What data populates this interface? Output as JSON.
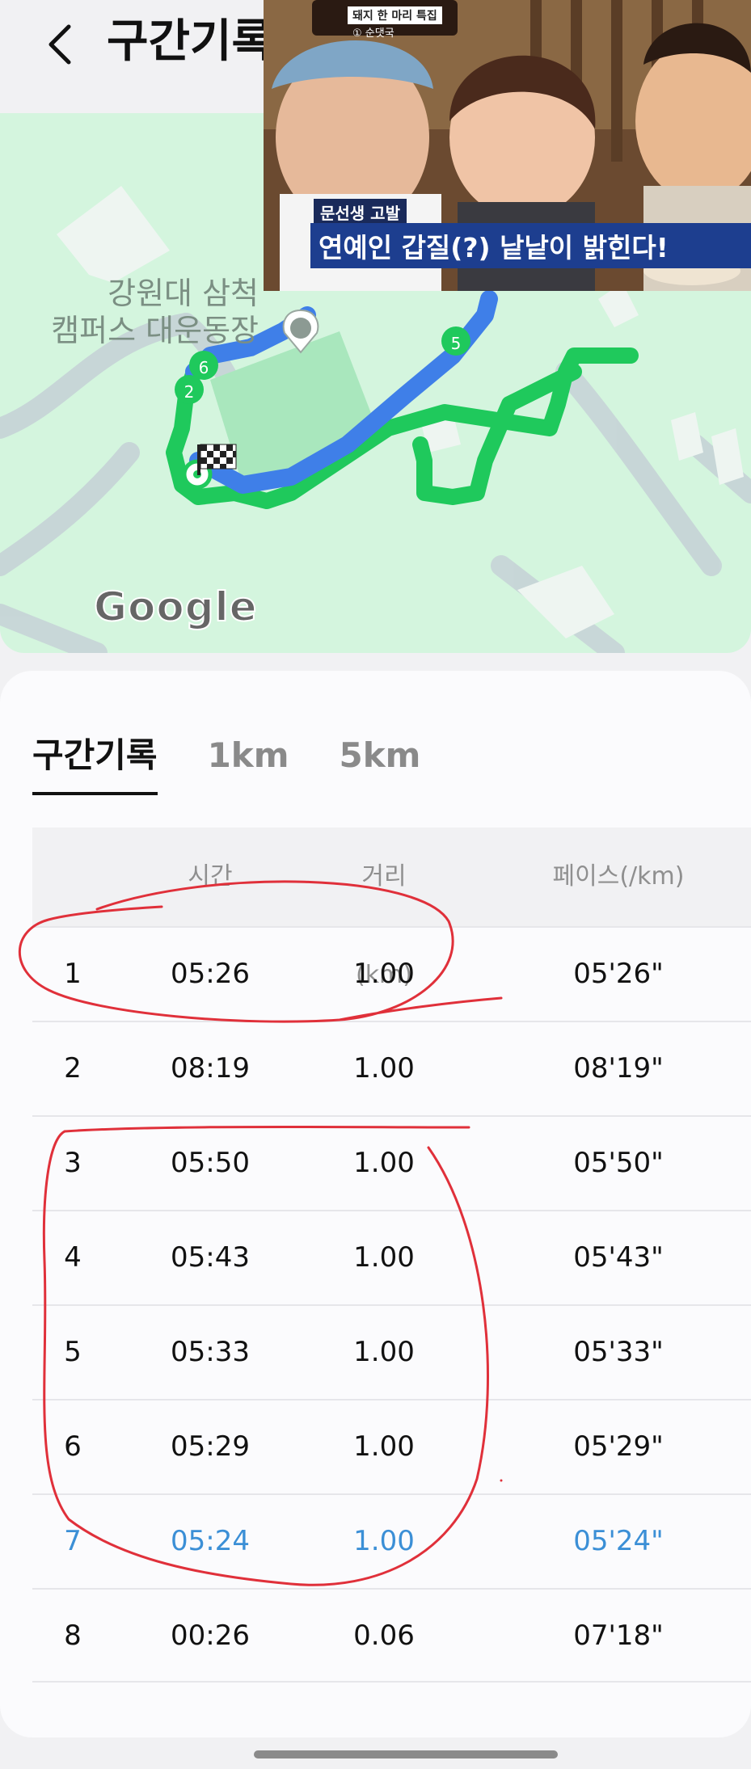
{
  "header": {
    "title": "구간기록"
  },
  "map": {
    "place_label_line1": "강원대 삼척",
    "place_label_line2": "캠퍼스 대운동장",
    "markers": [
      "6",
      "2",
      "5"
    ],
    "logo": "Google"
  },
  "video_overlay": {
    "show_badge": "돼지 한 마리 특집",
    "episode": "① 순댓국",
    "caption_small": "문선생 고발",
    "caption_main": "연예인 갑질(?) 낱낱이 밝힌다!"
  },
  "tabs": [
    {
      "label": "구간기록",
      "active": true
    },
    {
      "label": "1km",
      "active": false
    },
    {
      "label": "5km",
      "active": false
    }
  ],
  "table": {
    "headers": {
      "time": "시간",
      "distance": "거리(km)",
      "pace": "페이스(/km)"
    },
    "rows": [
      {
        "idx": "1",
        "time": "05:26",
        "distance": "1.00",
        "pace": "05'26\""
      },
      {
        "idx": "2",
        "time": "08:19",
        "distance": "1.00",
        "pace": "08'19\""
      },
      {
        "idx": "3",
        "time": "05:50",
        "distance": "1.00",
        "pace": "05'50\""
      },
      {
        "idx": "4",
        "time": "05:43",
        "distance": "1.00",
        "pace": "05'43\""
      },
      {
        "idx": "5",
        "time": "05:33",
        "distance": "1.00",
        "pace": "05'33\""
      },
      {
        "idx": "6",
        "time": "05:29",
        "distance": "1.00",
        "pace": "05'29\""
      },
      {
        "idx": "7",
        "time": "05:24",
        "distance": "1.00",
        "pace": "05'24\""
      },
      {
        "idx": "8",
        "time": "00:26",
        "distance": "0.06",
        "pace": "07'18\""
      }
    ],
    "highlighted_row": "7"
  },
  "colors": {
    "route_green": "#1fc95c",
    "route_blue": "#3f7fe8",
    "highlight_blue": "#3b8fd6",
    "annotation_red": "#e0303a",
    "map_bg": "#d4f5de"
  }
}
